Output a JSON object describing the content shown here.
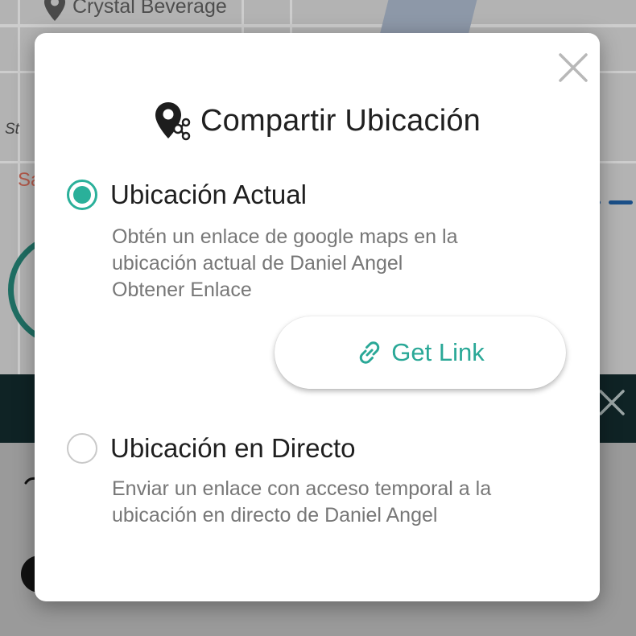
{
  "background_map": {
    "place_name": "Crystal Beverage",
    "street_abbrev": "St",
    "partial_label": "Sa"
  },
  "dialog": {
    "title": "Compartir Ubicación",
    "title_icon": "location-share-icon",
    "close_icon": "close-icon",
    "options": [
      {
        "label": "Ubicación Actual",
        "selected": true,
        "description_lines": [
          "Obtén un enlace de google maps en la",
          "ubicación actual de Daniel Angel",
          "Obtener Enlace"
        ]
      },
      {
        "label": "Ubicación en Directo",
        "selected": false,
        "description_lines": [
          "Enviar un enlace con acceso temporal a la",
          "ubicación en directo de Daniel Angel"
        ]
      }
    ],
    "get_link": {
      "label": "Get Link",
      "icon": "link-icon"
    }
  },
  "colors": {
    "accent": "#2ab09a",
    "link_text": "#2aa897",
    "title_text": "#202020",
    "description_text": "#777777",
    "close_icon": "#b8b8b8",
    "radio_unselected": "#c9c9c9",
    "dark_bar": "#0f2325"
  }
}
